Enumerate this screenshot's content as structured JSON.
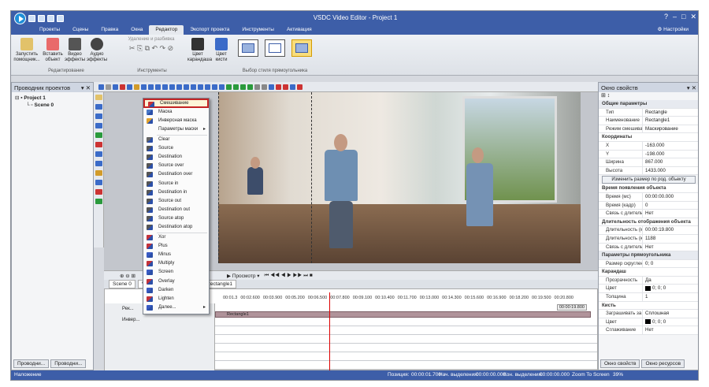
{
  "app": {
    "title": "VSDC Video Editor - Project 1",
    "options": "Настройки"
  },
  "menu": [
    "Проекты",
    "Сцены",
    "Правка",
    "Окна",
    "Редактор",
    "Экспорт проекта",
    "Инструменты",
    "Активация"
  ],
  "ribbon": {
    "launch": "Запустить помощник...",
    "insert": "Вставить объект",
    "video_fx": "Видео эффекты",
    "audio_fx": "Аудио эффекты",
    "group_edit": "Редактирование",
    "del_split": "Удаление и разбивка",
    "group_tools": "Инструменты",
    "pen_color": "Цвет карандаша",
    "brush_color": "Цвет кисти",
    "group_style": "Выбор стиля прямоугольника"
  },
  "explorer": {
    "title": "Проводник проектов",
    "project": "Project 1",
    "scene": "Scene 0"
  },
  "bottom_tabs": [
    "Проводни...",
    "Проводни..."
  ],
  "preview_btn": "Просмотр",
  "timeline_tabs": [
    "Scene 0",
    "Vid",
    "Rectangle1"
  ],
  "ruler": [
    "00:01.3",
    "00:02.600",
    "00:03.900",
    "00:05.200",
    "00:06.500",
    "00:07.800",
    "00:09.100",
    "00:10.400",
    "00:11.700",
    "00:13.000",
    "00:14.300",
    "00:15.600",
    "00:16.900",
    "00:18.200",
    "00:19.500",
    "00:20.800"
  ],
  "track": {
    "name": "Rectangle1",
    "layer": "Инвер...",
    "layer2": "Рек...",
    "time": "00:00:19.800"
  },
  "context_menu": [
    {
      "label": "Смешивание",
      "color": "#c33",
      "hl": true
    },
    {
      "label": "Маска",
      "color": "#4a79c7"
    },
    {
      "label": "Инверсная маска",
      "color": "#e0a12c"
    },
    {
      "label": "Параметры маски",
      "color": "",
      "arrow": "▸"
    },
    {
      "sep": true
    },
    {
      "label": "Clear",
      "color": "#666"
    },
    {
      "label": "Source",
      "color": "#555"
    },
    {
      "label": "Destination",
      "color": "#555"
    },
    {
      "label": "Source over",
      "color": "#555"
    },
    {
      "label": "Destination over",
      "color": "#555"
    },
    {
      "label": "Source in",
      "color": "#555"
    },
    {
      "label": "Destination in",
      "color": "#555"
    },
    {
      "label": "Source out",
      "color": "#555"
    },
    {
      "label": "Destination out",
      "color": "#555"
    },
    {
      "label": "Source atop",
      "color": "#555"
    },
    {
      "label": "Destination atop",
      "color": "#555"
    },
    {
      "sep": true
    },
    {
      "label": "Xor",
      "color": "#c3323a"
    },
    {
      "label": "Plus",
      "color": "#c3323a"
    },
    {
      "label": "Minus",
      "color": "#3a5bc3"
    },
    {
      "label": "Multiply",
      "color": "#c3323a"
    },
    {
      "label": "Screen",
      "color": "#3a5bc3"
    },
    {
      "label": "Overlay",
      "color": "#c3323a"
    },
    {
      "label": "Darken",
      "color": "#3a5bc3"
    },
    {
      "label": "Lighten",
      "color": "#c3323a"
    },
    {
      "label": "Далее...",
      "color": "#3a5bc3",
      "arrow": "▸"
    }
  ],
  "props": {
    "title": "Окно свойств",
    "rows": [
      {
        "sec": "Общие параметры"
      },
      {
        "k": "Тип",
        "v": "Rectangle"
      },
      {
        "k": "Наименование",
        "v": "Rectangle1"
      },
      {
        "k": "Режим смешивания",
        "v": "Маскирование"
      },
      {
        "sub": "Координаты"
      },
      {
        "k": "X",
        "v": "-163.000"
      },
      {
        "k": "Y",
        "v": "-198.000"
      },
      {
        "k": "Ширина",
        "v": "867.000"
      },
      {
        "k": "Высота",
        "v": "1433.000"
      },
      {
        "btn": "Изменить размер по род. объекту"
      },
      {
        "sub": "Время появления объекта"
      },
      {
        "k": "Время (мс)",
        "v": "00:00:00.000"
      },
      {
        "k": "Время (кадр)",
        "v": "0"
      },
      {
        "k": "Связь с длительн",
        "v": "Нет"
      },
      {
        "sub": "Длительность отображения объекта"
      },
      {
        "k": "Длительность (мс",
        "v": "00:00:19.800"
      },
      {
        "k": "Длительность (к",
        "v": "1188"
      },
      {
        "k": "Связь с длительн",
        "v": "Нет"
      },
      {
        "sec": "Параметры прямоугольника"
      },
      {
        "k": "Размер скругления",
        "v": "0; 0"
      },
      {
        "sub": "Карандаш"
      },
      {
        "k": "Прозрачность",
        "v": "Да"
      },
      {
        "k": "Цвет",
        "v": "0; 0; 0",
        "swatch": true
      },
      {
        "k": "Толщина",
        "v": "1"
      },
      {
        "sub": "Кисть"
      },
      {
        "k": "Заграшивать за",
        "v": "Сплошная"
      },
      {
        "k": "Цвет",
        "v": "0; 0; 0",
        "swatch": true
      },
      {
        "k": "Сглаживание",
        "v": "Нет"
      }
    ],
    "tabs": [
      "Окно свойств",
      "Окно ресурсов"
    ]
  },
  "status": {
    "left": "Наложение",
    "pos_label": "Позиция:",
    "pos": "00:00:01.700",
    "sel_start_label": "Нач. выделения:",
    "sel_start": "00:00:00.000",
    "sel_end_label": "Кон. выделения:",
    "sel_end": "00:00:00.000",
    "zoom": "Zoom To Screen",
    "pct": "39%"
  }
}
